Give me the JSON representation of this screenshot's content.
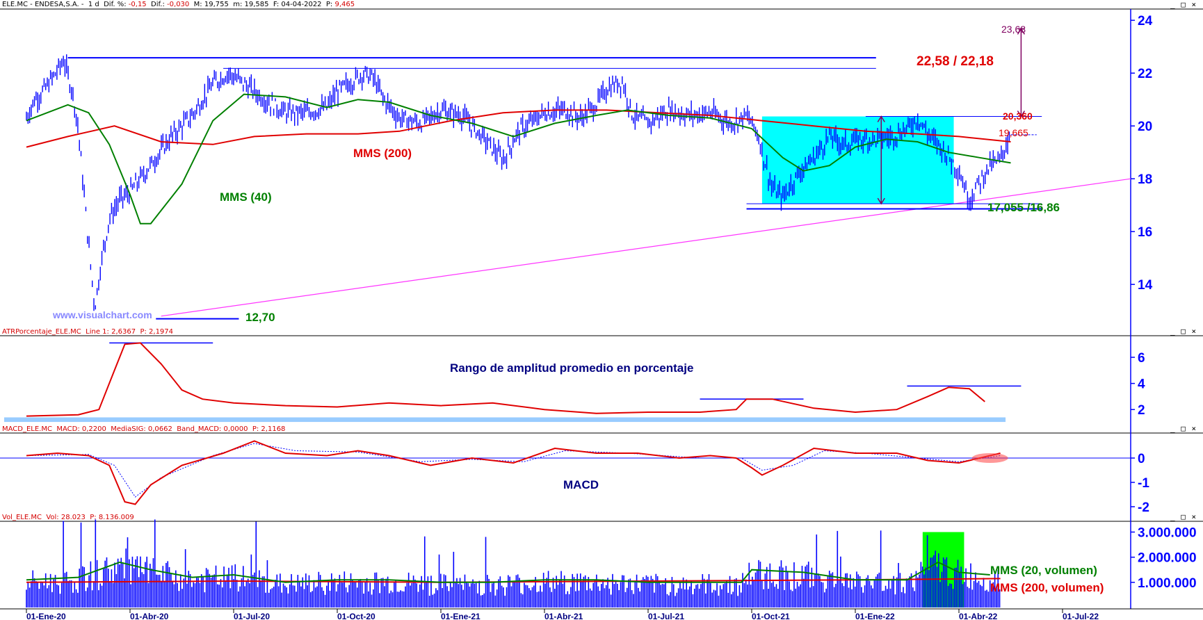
{
  "header_main": {
    "symbol": "ELE.MC - ENDESA,S.A. -",
    "period": "1 d",
    "dif_pct_label": "Dif. %:",
    "dif_pct_value": "-0,15",
    "dif_label": "Dif.:",
    "dif_value": "-0,030",
    "max_label": "M:",
    "max_value": "19,755",
    "min_label": "m:",
    "min_value": "19,585",
    "date_label": "F:",
    "date_value": "04-04-2022",
    "p_label": "P:",
    "p_value": "9,465"
  },
  "header_atr": {
    "name": "ATRPorcentaje_ELE.MC",
    "line_label": "Line 1:",
    "line_value": "2,6367",
    "p_label": "P:",
    "p_value": "2,1974"
  },
  "header_macd": {
    "name": "MACD_ELE.MC",
    "macd_label": "MACD:",
    "macd_value": "0,2200",
    "sig_label": "MediaSIG:",
    "sig_value": "0,0662",
    "band_label": "Band_MACD:",
    "band_value": "0,0000",
    "p_label": "P:",
    "p_value": "2,1168"
  },
  "header_vol": {
    "name": "Vol_ELE.MC",
    "vol_label": "Vol:",
    "vol_value": "28.023",
    "p_label": "P:",
    "p_value": "8.136.009"
  },
  "window_buttons": "_ □ ×",
  "watermark": "www.visualchart.com",
  "annotations": {
    "resistance": "22,58 / 22,18",
    "target": "23,68",
    "box_top": "20,360",
    "last_price": "19,665",
    "support": "17,055 /16,86",
    "low": "12,70",
    "mms200": "MMS (200)",
    "mms40": "MMS (40)",
    "atr_title": "Rango de amplitud promedio en porcentaje",
    "macd_title": "MACD",
    "vol_mms20": "MMS (20, volumen)",
    "vol_mms200": "MMS (200, volumen)"
  },
  "colors": {
    "axis": "#0000ff",
    "price": "#0000ff",
    "mms200": "#e00000",
    "mms40": "#008000",
    "box": "#00ffff",
    "trend": "#ff33ff",
    "target": "#800060",
    "vol_highlight": "#00ff00",
    "atr_band": "#99ccff"
  },
  "chart_data": [
    {
      "type": "line",
      "panel": "price",
      "y_ticks": [
        "24",
        "22",
        "20",
        "18",
        "16",
        "14"
      ],
      "ylim": [
        12.4,
        24.4
      ],
      "x_ticks": [
        "01-Ene-20",
        "01-Abr-20",
        "01-Jul-20",
        "01-Oct-20",
        "01-Ene-21",
        "01-Abr-21",
        "01-Jul-21",
        "01-Oct-21",
        "01-Ene-22",
        "01-Abr-22",
        "01-Jul-22"
      ],
      "price_points": [
        [
          0,
          20.3
        ],
        [
          0.08,
          21
        ],
        [
          0.18,
          21.4
        ],
        [
          0.3,
          22.1
        ],
        [
          0.36,
          22.5
        ],
        [
          0.45,
          21.2
        ],
        [
          0.5,
          19.9
        ],
        [
          0.6,
          15.5
        ],
        [
          0.66,
          13.1
        ],
        [
          0.72,
          14.8
        ],
        [
          0.8,
          16.5
        ],
        [
          0.9,
          17.2
        ],
        [
          1.0,
          17.5
        ],
        [
          1.1,
          18
        ],
        [
          1.25,
          18.8
        ],
        [
          1.4,
          19.6
        ],
        [
          1.6,
          20.4
        ],
        [
          1.8,
          21.6
        ],
        [
          1.95,
          22
        ],
        [
          2.1,
          21.6
        ],
        [
          2.3,
          21
        ],
        [
          2.5,
          20.5
        ],
        [
          2.7,
          20.5
        ],
        [
          2.9,
          20.7
        ],
        [
          3.0,
          21.3
        ],
        [
          3.15,
          21.7
        ],
        [
          3.25,
          22
        ],
        [
          3.35,
          21.8
        ],
        [
          3.45,
          21
        ],
        [
          3.6,
          20.3
        ],
        [
          3.8,
          20.1
        ],
        [
          4.0,
          20.6
        ],
        [
          4.2,
          20.4
        ],
        [
          4.4,
          19.6
        ],
        [
          4.6,
          18.7
        ],
        [
          4.75,
          19.8
        ],
        [
          5.0,
          20.5
        ],
        [
          5.2,
          20.6
        ],
        [
          5.35,
          20.3
        ],
        [
          5.5,
          20.8
        ],
        [
          5.6,
          21.4
        ],
        [
          5.75,
          21.7
        ],
        [
          5.85,
          20.4
        ],
        [
          6.0,
          20.1
        ],
        [
          6.2,
          20.6
        ],
        [
          6.4,
          20.4
        ],
        [
          6.6,
          20.5
        ],
        [
          6.8,
          20.1
        ],
        [
          6.95,
          20.4
        ],
        [
          7.05,
          19.8
        ],
        [
          7.15,
          18.3
        ],
        [
          7.2,
          17.6
        ],
        [
          7.3,
          17.3
        ],
        [
          7.45,
          18.2
        ],
        [
          7.6,
          18.8
        ],
        [
          7.75,
          19.6
        ],
        [
          7.9,
          19.3
        ],
        [
          8.05,
          19.5
        ],
        [
          8.2,
          19.5
        ],
        [
          8.35,
          19.6
        ],
        [
          8.5,
          19.9
        ],
        [
          8.6,
          20.3
        ],
        [
          8.7,
          19.7
        ],
        [
          8.85,
          19.1
        ],
        [
          9.0,
          18.3
        ],
        [
          9.1,
          17.2
        ],
        [
          9.2,
          17.9
        ],
        [
          9.3,
          18.5
        ],
        [
          9.4,
          18.7
        ],
        [
          9.45,
          19.3
        ],
        [
          9.5,
          19.6
        ]
      ],
      "mms40_points": [
        [
          0,
          20.2
        ],
        [
          0.4,
          20.8
        ],
        [
          0.6,
          20.5
        ],
        [
          0.8,
          19.3
        ],
        [
          1.0,
          17.4
        ],
        [
          1.1,
          16.3
        ],
        [
          1.2,
          16.3
        ],
        [
          1.5,
          17.8
        ],
        [
          1.8,
          20.2
        ],
        [
          2.1,
          21.2
        ],
        [
          2.5,
          21.1
        ],
        [
          2.9,
          20.7
        ],
        [
          3.2,
          21
        ],
        [
          3.5,
          20.9
        ],
        [
          3.9,
          20.4
        ],
        [
          4.3,
          20.1
        ],
        [
          4.7,
          19.6
        ],
        [
          5.1,
          20.1
        ],
        [
          5.5,
          20.4
        ],
        [
          5.8,
          20.6
        ],
        [
          6.2,
          20.4
        ],
        [
          6.6,
          20.3
        ],
        [
          7.0,
          19.9
        ],
        [
          7.3,
          18.8
        ],
        [
          7.5,
          18.3
        ],
        [
          7.75,
          18.5
        ],
        [
          8.0,
          19.2
        ],
        [
          8.3,
          19.5
        ],
        [
          8.6,
          19.4
        ],
        [
          8.9,
          19
        ],
        [
          9.2,
          18.8
        ],
        [
          9.5,
          18.6
        ]
      ],
      "mms200_points": [
        [
          0,
          19.2
        ],
        [
          0.4,
          19.6
        ],
        [
          0.85,
          20
        ],
        [
          1.3,
          19.4
        ],
        [
          1.8,
          19.3
        ],
        [
          2.2,
          19.6
        ],
        [
          2.7,
          19.7
        ],
        [
          3.2,
          19.7
        ],
        [
          3.6,
          19.8
        ],
        [
          4.1,
          20.2
        ],
        [
          4.6,
          20.5
        ],
        [
          5.1,
          20.6
        ],
        [
          5.6,
          20.6
        ],
        [
          6.1,
          20.5
        ],
        [
          6.6,
          20.4
        ],
        [
          7.1,
          20.2
        ],
        [
          7.6,
          20
        ],
        [
          8.1,
          19.8
        ],
        [
          8.6,
          19.7
        ],
        [
          9.0,
          19.6
        ],
        [
          9.5,
          19.4
        ]
      ],
      "trendline": [
        [
          1.3,
          12.8
        ],
        [
          10.4,
          18
        ]
      ],
      "resistance_levels": [
        22.58,
        22.18
      ],
      "support_levels": [
        17.055,
        16.86
      ],
      "box_range": [
        17.055,
        20.36
      ],
      "target_level": 23.68,
      "low_level": 12.7
    },
    {
      "type": "line",
      "panel": "atr",
      "y_ticks": [
        "6",
        "4",
        "2"
      ],
      "ylim": [
        1,
        7.6
      ],
      "atr_points": [
        [
          0,
          1.5
        ],
        [
          0.5,
          1.6
        ],
        [
          0.7,
          2
        ],
        [
          0.85,
          5
        ],
        [
          0.95,
          7
        ],
        [
          1.1,
          7.1
        ],
        [
          1.3,
          5.5
        ],
        [
          1.5,
          3.5
        ],
        [
          1.7,
          2.8
        ],
        [
          2.0,
          2.5
        ],
        [
          2.5,
          2.3
        ],
        [
          3.0,
          2.2
        ],
        [
          3.5,
          2.5
        ],
        [
          4.0,
          2.3
        ],
        [
          4.5,
          2.5
        ],
        [
          5.0,
          2
        ],
        [
          5.5,
          1.7
        ],
        [
          6.0,
          1.8
        ],
        [
          6.5,
          1.8
        ],
        [
          6.85,
          2
        ],
        [
          6.95,
          2.8
        ],
        [
          7.2,
          2.8
        ],
        [
          7.6,
          2.1
        ],
        [
          8.0,
          1.8
        ],
        [
          8.4,
          2
        ],
        [
          8.7,
          3
        ],
        [
          8.9,
          3.7
        ],
        [
          9.1,
          3.6
        ],
        [
          9.25,
          2.6
        ]
      ],
      "level_lines": [
        [
          0.8,
          1.8,
          7.1
        ],
        [
          6.5,
          7.5,
          2.8
        ],
        [
          8.5,
          9.6,
          3.8
        ]
      ]
    },
    {
      "type": "line",
      "panel": "macd",
      "y_ticks": [
        "0",
        "-1",
        "-2"
      ],
      "ylim": [
        -2.2,
        1.0
      ],
      "macd_points": [
        [
          0,
          0.1
        ],
        [
          0.3,
          0.2
        ],
        [
          0.6,
          0.1
        ],
        [
          0.8,
          -0.3
        ],
        [
          0.95,
          -1.8
        ],
        [
          1.05,
          -1.9
        ],
        [
          1.2,
          -1.1
        ],
        [
          1.5,
          -0.3
        ],
        [
          1.9,
          0.2
        ],
        [
          2.2,
          0.7
        ],
        [
          2.5,
          0.2
        ],
        [
          2.9,
          0.1
        ],
        [
          3.2,
          0.3
        ],
        [
          3.5,
          0.1
        ],
        [
          3.9,
          -0.3
        ],
        [
          4.3,
          0
        ],
        [
          4.7,
          -0.2
        ],
        [
          5.1,
          0.4
        ],
        [
          5.5,
          0.2
        ],
        [
          5.9,
          0.2
        ],
        [
          6.3,
          0
        ],
        [
          6.6,
          0.1
        ],
        [
          6.85,
          0
        ],
        [
          7.0,
          -0.4
        ],
        [
          7.1,
          -0.7
        ],
        [
          7.3,
          -0.3
        ],
        [
          7.6,
          0.4
        ],
        [
          8.0,
          0.2
        ],
        [
          8.4,
          0.2
        ],
        [
          8.7,
          -0.1
        ],
        [
          9.0,
          -0.2
        ],
        [
          9.3,
          0.1
        ],
        [
          9.4,
          0.2
        ]
      ],
      "signal_points": [
        [
          0,
          0.1
        ],
        [
          0.6,
          0.15
        ],
        [
          0.85,
          -0.3
        ],
        [
          1.05,
          -1.6
        ],
        [
          1.3,
          -0.8
        ],
        [
          1.8,
          0.1
        ],
        [
          2.2,
          0.6
        ],
        [
          2.6,
          0.3
        ],
        [
          3.2,
          0.25
        ],
        [
          3.8,
          -0.15
        ],
        [
          4.3,
          -0.05
        ],
        [
          4.8,
          -0.15
        ],
        [
          5.2,
          0.3
        ],
        [
          5.8,
          0.2
        ],
        [
          6.5,
          0
        ],
        [
          6.9,
          0
        ],
        [
          7.1,
          -0.5
        ],
        [
          7.4,
          -0.3
        ],
        [
          7.7,
          0.3
        ],
        [
          8.1,
          0.2
        ],
        [
          8.6,
          0
        ],
        [
          9.0,
          -0.15
        ],
        [
          9.4,
          0.1
        ]
      ]
    },
    {
      "type": "bar",
      "panel": "volume",
      "y_ticks": [
        "3.000.000",
        "2.000.000",
        "1.000.000"
      ],
      "ylim": [
        0,
        3400000
      ],
      "mms20_points": [
        [
          0,
          1100000
        ],
        [
          0.5,
          1200000
        ],
        [
          0.9,
          1800000
        ],
        [
          1.2,
          1500000
        ],
        [
          1.6,
          1200000
        ],
        [
          2.0,
          1300000
        ],
        [
          2.5,
          1000000
        ],
        [
          3.0,
          1100000
        ],
        [
          3.5,
          1100000
        ],
        [
          4.0,
          1000000
        ],
        [
          4.5,
          1000000
        ],
        [
          5.0,
          1100000
        ],
        [
          5.5,
          1100000
        ],
        [
          6.0,
          1000000
        ],
        [
          6.5,
          1000000
        ],
        [
          6.9,
          1000000
        ],
        [
          7.0,
          1500000
        ],
        [
          7.5,
          1400000
        ],
        [
          8.0,
          1100000
        ],
        [
          8.5,
          1100000
        ],
        [
          8.8,
          1800000
        ],
        [
          9.0,
          1400000
        ],
        [
          9.3,
          1300000
        ]
      ],
      "mms200_points": [
        [
          0,
          1000000
        ],
        [
          2,
          1050000
        ],
        [
          4,
          1000000
        ],
        [
          6,
          1050000
        ],
        [
          8,
          1100000
        ],
        [
          9.4,
          1150000
        ]
      ],
      "highlight_range": [
        8.65,
        9.05
      ],
      "highlight_height": 3000000,
      "max_volume": 3500000
    }
  ]
}
